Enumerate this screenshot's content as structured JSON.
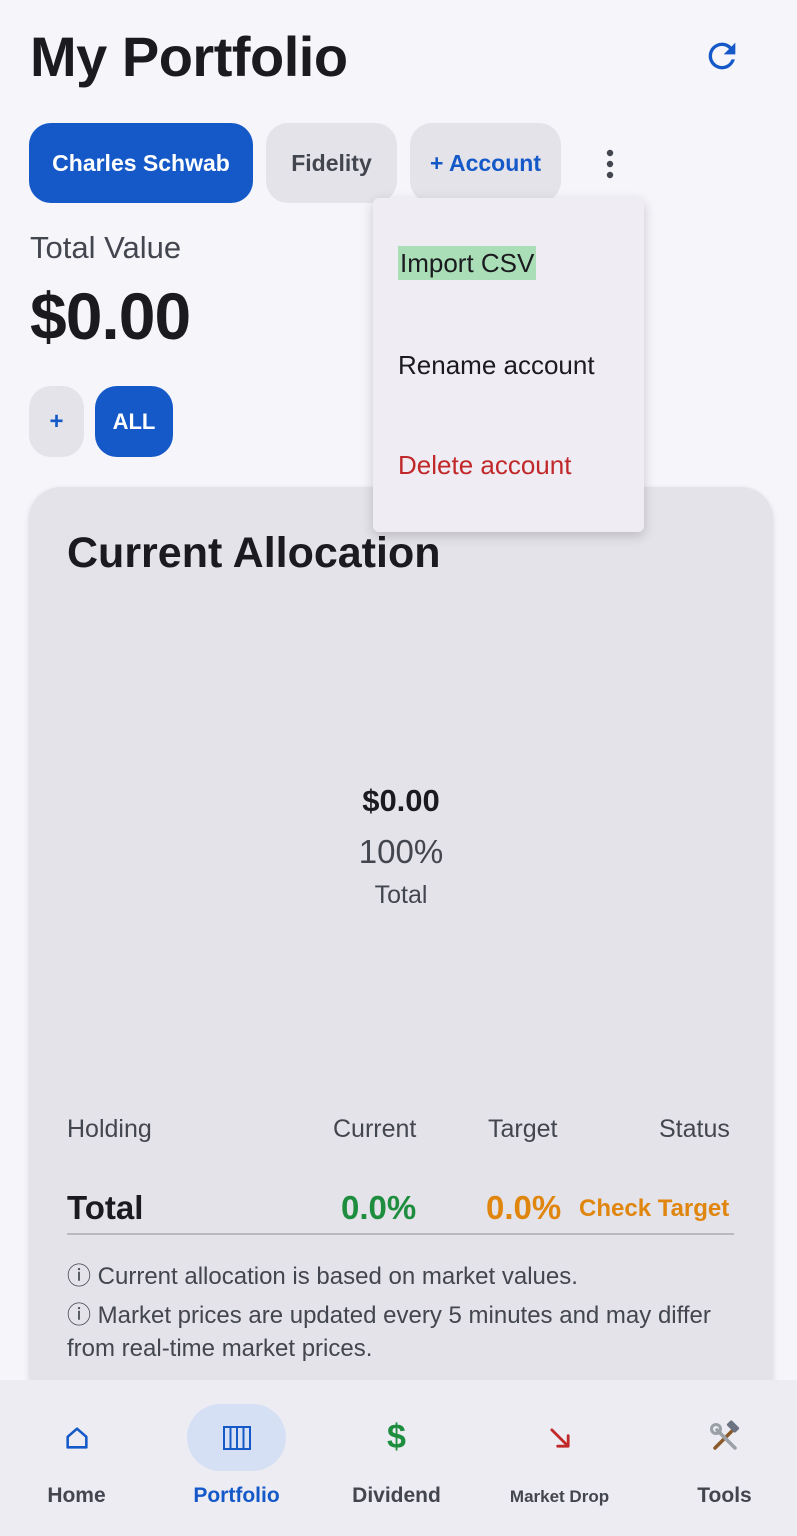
{
  "header": {
    "title": "My Portfolio"
  },
  "accounts": {
    "active": "Charles Schwab",
    "other": "Fidelity",
    "add": "+ Account"
  },
  "summary": {
    "label": "Total Value",
    "value": "$0.00"
  },
  "filters": {
    "add": "+",
    "all": "ALL"
  },
  "allocation": {
    "title": "Current Allocation",
    "center_amount": "$0.00",
    "center_percent": "100%",
    "center_label": "Total",
    "columns": {
      "holding": "Holding",
      "current": "Current",
      "target": "Target",
      "status": "Status"
    },
    "total_row": {
      "label": "Total",
      "current": "0.0%",
      "target": "0.0%",
      "status": "Check Target"
    },
    "notes": [
      "ⓘ Current allocation is based on market values.",
      "ⓘ Market prices are updated every 5 minutes and may differ from real-time market prices."
    ]
  },
  "menu": {
    "items": [
      "Import CSV",
      "Rename account",
      "Delete account"
    ]
  },
  "nav": {
    "items": [
      "Home",
      "Portfolio",
      "Dividend",
      "Market Drop",
      "Tools"
    ],
    "active": "Portfolio"
  },
  "colors": {
    "primary": "#1559c8",
    "positive": "#1e8e3e",
    "warning": "#e0860e",
    "danger": "#c0282a",
    "highlight": "#a9deb7"
  }
}
